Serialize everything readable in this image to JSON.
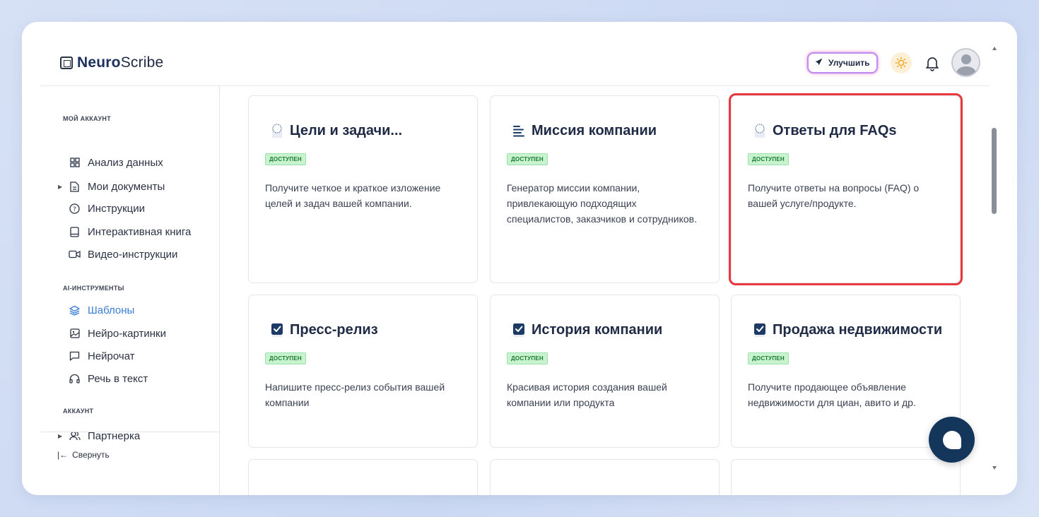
{
  "header": {
    "logo_bold": "Neuro",
    "logo_rest": "Scribe",
    "upgrade_label": "Улучшить"
  },
  "sidebar": {
    "section_account": "МОЙ АККАУНТ",
    "account_items": [
      {
        "label": "Анализ данных",
        "icon": "grid-icon"
      },
      {
        "label": "Мои документы",
        "icon": "document-icon"
      },
      {
        "label": "Инструкции",
        "icon": "help-icon"
      },
      {
        "label": "Интерактивная книга",
        "icon": "book-icon"
      },
      {
        "label": "Видео-инструкции",
        "icon": "video-icon"
      }
    ],
    "section_ai": "AI-ИНСТРУМЕНТЫ",
    "ai_items": [
      {
        "label": "Шаблоны",
        "icon": "layers-icon"
      },
      {
        "label": "Нейро-картинки",
        "icon": "image-icon"
      },
      {
        "label": "Нейрочат",
        "icon": "chat-icon"
      },
      {
        "label": "Речь в текст",
        "icon": "headphones-icon"
      }
    ],
    "section_acc": "АККАУНТ",
    "acc_items": [
      {
        "label": "Партнерка",
        "icon": "users-icon"
      }
    ],
    "collapse_label": "Свернуть"
  },
  "cards": [
    {
      "title": "Цели и задачи...",
      "badge": "ДОСТУПЕН",
      "desc": "Получите четкое и краткое изложение целей и задач вашей компании."
    },
    {
      "title": "Миссия компании",
      "badge": "ДОСТУПЕН",
      "desc": "Генератор миссии компании, привлекающую подходящих специалистов, заказчиков и сотрудников."
    },
    {
      "title": "Ответы для FAQs",
      "badge": "ДОСТУПЕН",
      "desc": "Получите ответы на вопросы (FAQ) о вашей услуге/продукте."
    },
    {
      "title": "Пресс-релиз",
      "badge": "ДОСТУПЕН",
      "desc": "Напишите пресс-релиз события вашей компании"
    },
    {
      "title": "История компании",
      "badge": "ДОСТУПЕН",
      "desc": "Красивая история создания вашей компании или продукта"
    },
    {
      "title": "Продажа недвижимости",
      "badge": "ДОСТУПЕН",
      "desc": "Получите продающее объявление недвижимости для циан, авито и др."
    }
  ]
}
